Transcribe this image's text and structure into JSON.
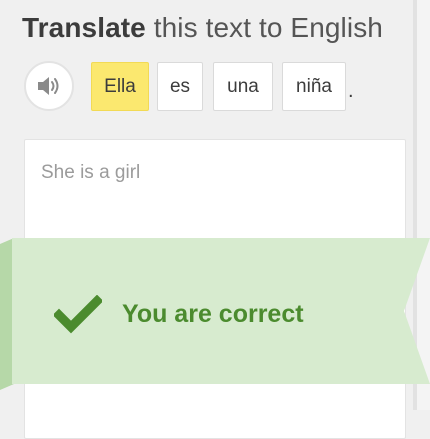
{
  "prompt": {
    "verb": "Translate",
    "rest": " this text to English"
  },
  "audio": {
    "icon": "speaker-icon"
  },
  "sentence": {
    "words": [
      "Ella",
      "es",
      "una",
      "niña"
    ],
    "punctuation": "."
  },
  "answer": {
    "value": "She is a girl"
  },
  "feedback": {
    "message": "You are correct",
    "icon": "checkmark-icon"
  },
  "colors": {
    "highlight": "#fbe86f",
    "success_text": "#4b8b2e",
    "banner": "#d7ebcf"
  }
}
